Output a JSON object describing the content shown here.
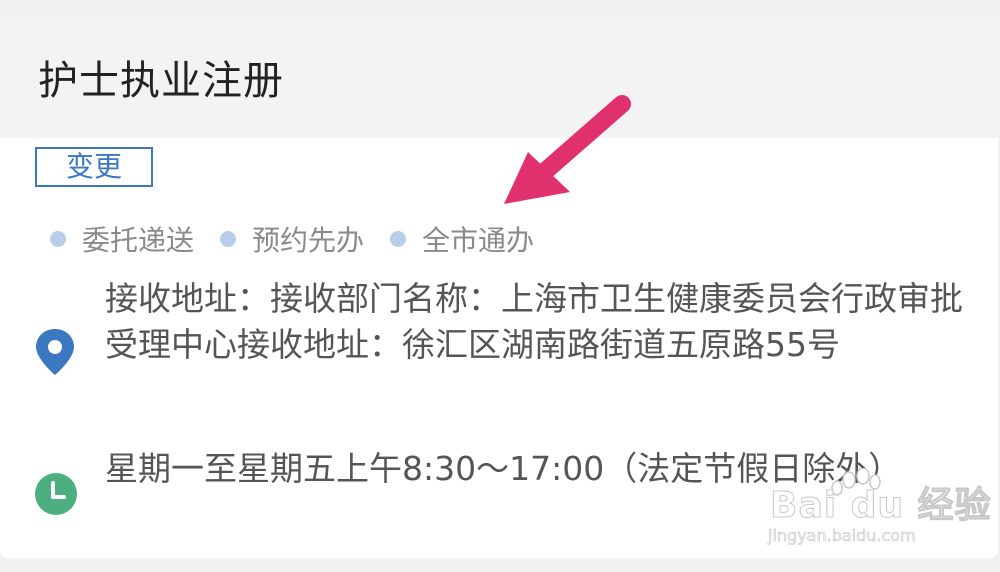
{
  "header": {
    "title": "护士执业注册"
  },
  "actions": {
    "change_label": "变更"
  },
  "tags": [
    {
      "label": "委托递送"
    },
    {
      "label": "预约先办"
    },
    {
      "label": "全市通办"
    }
  ],
  "address": {
    "icon": "location-pin-icon",
    "text": "接收地址：接收部门名称：上海市卫生健康委员会行政审批受理中心接收地址：徐汇区湖南路街道五原路55号"
  },
  "hours": {
    "icon": "clock-icon",
    "text": "星期一至星期五上午8:30～17:00（法定节假日除外）"
  },
  "annotation": {
    "arrow_color": "#e0306e"
  },
  "watermark": {
    "brand": "Bai du 经验",
    "url": "jingyan.baidu.com"
  },
  "colors": {
    "accent": "#3a78c2",
    "tag_dot": "#b8cdea",
    "clock": "#4caf80"
  }
}
